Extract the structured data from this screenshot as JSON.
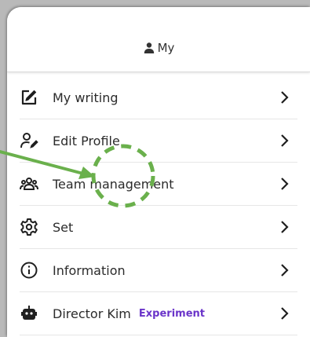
{
  "header": {
    "title": "My",
    "icon": "person-icon"
  },
  "menu": {
    "items": [
      {
        "label": "My writing",
        "icon": "edit-square-icon"
      },
      {
        "label": "Edit Profile",
        "icon": "person-edit-icon"
      },
      {
        "label": "Team management",
        "icon": "team-icon"
      },
      {
        "label": "Set",
        "icon": "gear-icon"
      },
      {
        "label": "Information",
        "icon": "info-icon"
      },
      {
        "label": "Director Kim",
        "icon": "robot-icon",
        "badge": "Experiment"
      }
    ]
  },
  "colors": {
    "badge": "#6a34c9",
    "annotation": "#6ab04c",
    "background": "#b9b9b9"
  }
}
